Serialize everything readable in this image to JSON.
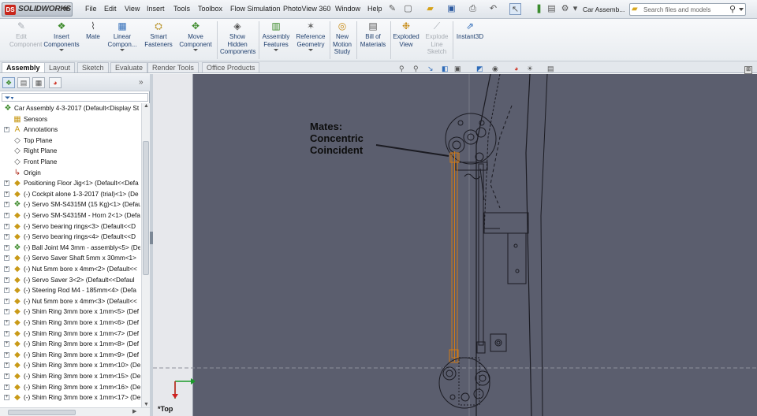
{
  "app": {
    "brand": "SOLIDWORKS",
    "doc_title": "Car Assemb..."
  },
  "menu": [
    "File",
    "Edit",
    "View",
    "Insert",
    "Tools",
    "Toolbox",
    "Flow Simulation",
    "PhotoView 360",
    "Window",
    "Help"
  ],
  "search": {
    "placeholder": "Search files and models"
  },
  "ribbon": {
    "edit_component": "Edit Component",
    "insert_components": "Insert Components",
    "mate": "Mate",
    "linear_component": "Linear Compon...",
    "smart_fasteners": "Smart Fasteners",
    "move_component": "Move Component",
    "show_hidden_components": "Show Hidden Components",
    "assembly_features": "Assembly Features",
    "reference_geometry": "Reference Geometry",
    "new_motion_study": "New Motion Study",
    "bill_of_materials": "Bill of Materials",
    "exploded_view": "Exploded View",
    "explode_line_sketch": "Explode Line Sketch",
    "instant3d": "Instant3D"
  },
  "tabs": [
    "Assembly",
    "Layout",
    "Sketch",
    "Evaluate",
    "Render Tools",
    "Office Products"
  ],
  "tree": [
    {
      "label": "Car Assembly 4-3-2017  (Default<Display St",
      "icon": "assembly-icon"
    },
    {
      "label": "Sensors",
      "icon": "sensors-folder-icon"
    },
    {
      "label": "Annotations",
      "icon": "annotations-icon"
    },
    {
      "label": "Top Plane",
      "icon": "plane-icon"
    },
    {
      "label": "Right Plane",
      "icon": "plane-icon"
    },
    {
      "label": "Front Plane",
      "icon": "plane-icon"
    },
    {
      "label": "Origin",
      "icon": "origin-icon"
    },
    {
      "label": "Positioning Floor Jig<1> (Default<<Defa",
      "icon": "part-icon"
    },
    {
      "label": "(-) Cockpit alone 1-3-2017 (trial)<1> (De",
      "icon": "part-icon"
    },
    {
      "label": "(-) Servo SM-S4315M (15 Kg)<1> (Defau",
      "icon": "subassembly-icon"
    },
    {
      "label": "(-) Servo SM-S4315M - Horn 2<1> (Defa",
      "icon": "part-icon"
    },
    {
      "label": "(-) Servo bearing rings<3> (Default<<D",
      "icon": "part-icon"
    },
    {
      "label": "(-) Servo bearing rings<4> (Default<<D",
      "icon": "part-icon"
    },
    {
      "label": "(-) Ball Joint M4 3mm - assembly<5> (De",
      "icon": "subassembly-icon"
    },
    {
      "label": "(-) Servo Saver Shaft 5mm x 30mm<1>",
      "icon": "part-icon"
    },
    {
      "label": "(-) Nut 5mm bore x 4mm<2> (Default<<",
      "icon": "part-icon"
    },
    {
      "label": "(-) Servo Saver 3<2> (Default<<Defaul",
      "icon": "part-icon"
    },
    {
      "label": "(-) Steering Rod M4 - 185mm<4> (Defa",
      "icon": "part-icon"
    },
    {
      "label": "(-) Nut 5mm bore x 4mm<3> (Default<<",
      "icon": "part-icon"
    },
    {
      "label": "(-) Shim Ring 3mm bore x 1mm<5> (Def",
      "icon": "part-icon"
    },
    {
      "label": "(-) Shim Ring 3mm bore x 1mm<6> (Def",
      "icon": "part-icon"
    },
    {
      "label": "(-) Shim Ring 3mm bore x 1mm<7> (Def",
      "icon": "part-icon"
    },
    {
      "label": "(-) Shim Ring 3mm bore x 1mm<8> (Def",
      "icon": "part-icon"
    },
    {
      "label": "(-) Shim Ring 3mm bore x 1mm<9> (Def",
      "icon": "part-icon"
    },
    {
      "label": "(-) Shim Ring 3mm bore x 1mm<10> (De",
      "icon": "part-icon"
    },
    {
      "label": "(-) Shim Ring 3mm bore x 1mm<15> (De",
      "icon": "part-icon"
    },
    {
      "label": "(-) Shim Ring 3mm bore x 1mm<16> (De",
      "icon": "part-icon"
    },
    {
      "label": "(-) Shim Ring 3mm bore x 1mm<17> (De",
      "icon": "part-icon"
    }
  ],
  "viewport": {
    "annotation": [
      "Mates:",
      "Concentric",
      "Coincident"
    ],
    "view_label": "*Top"
  }
}
